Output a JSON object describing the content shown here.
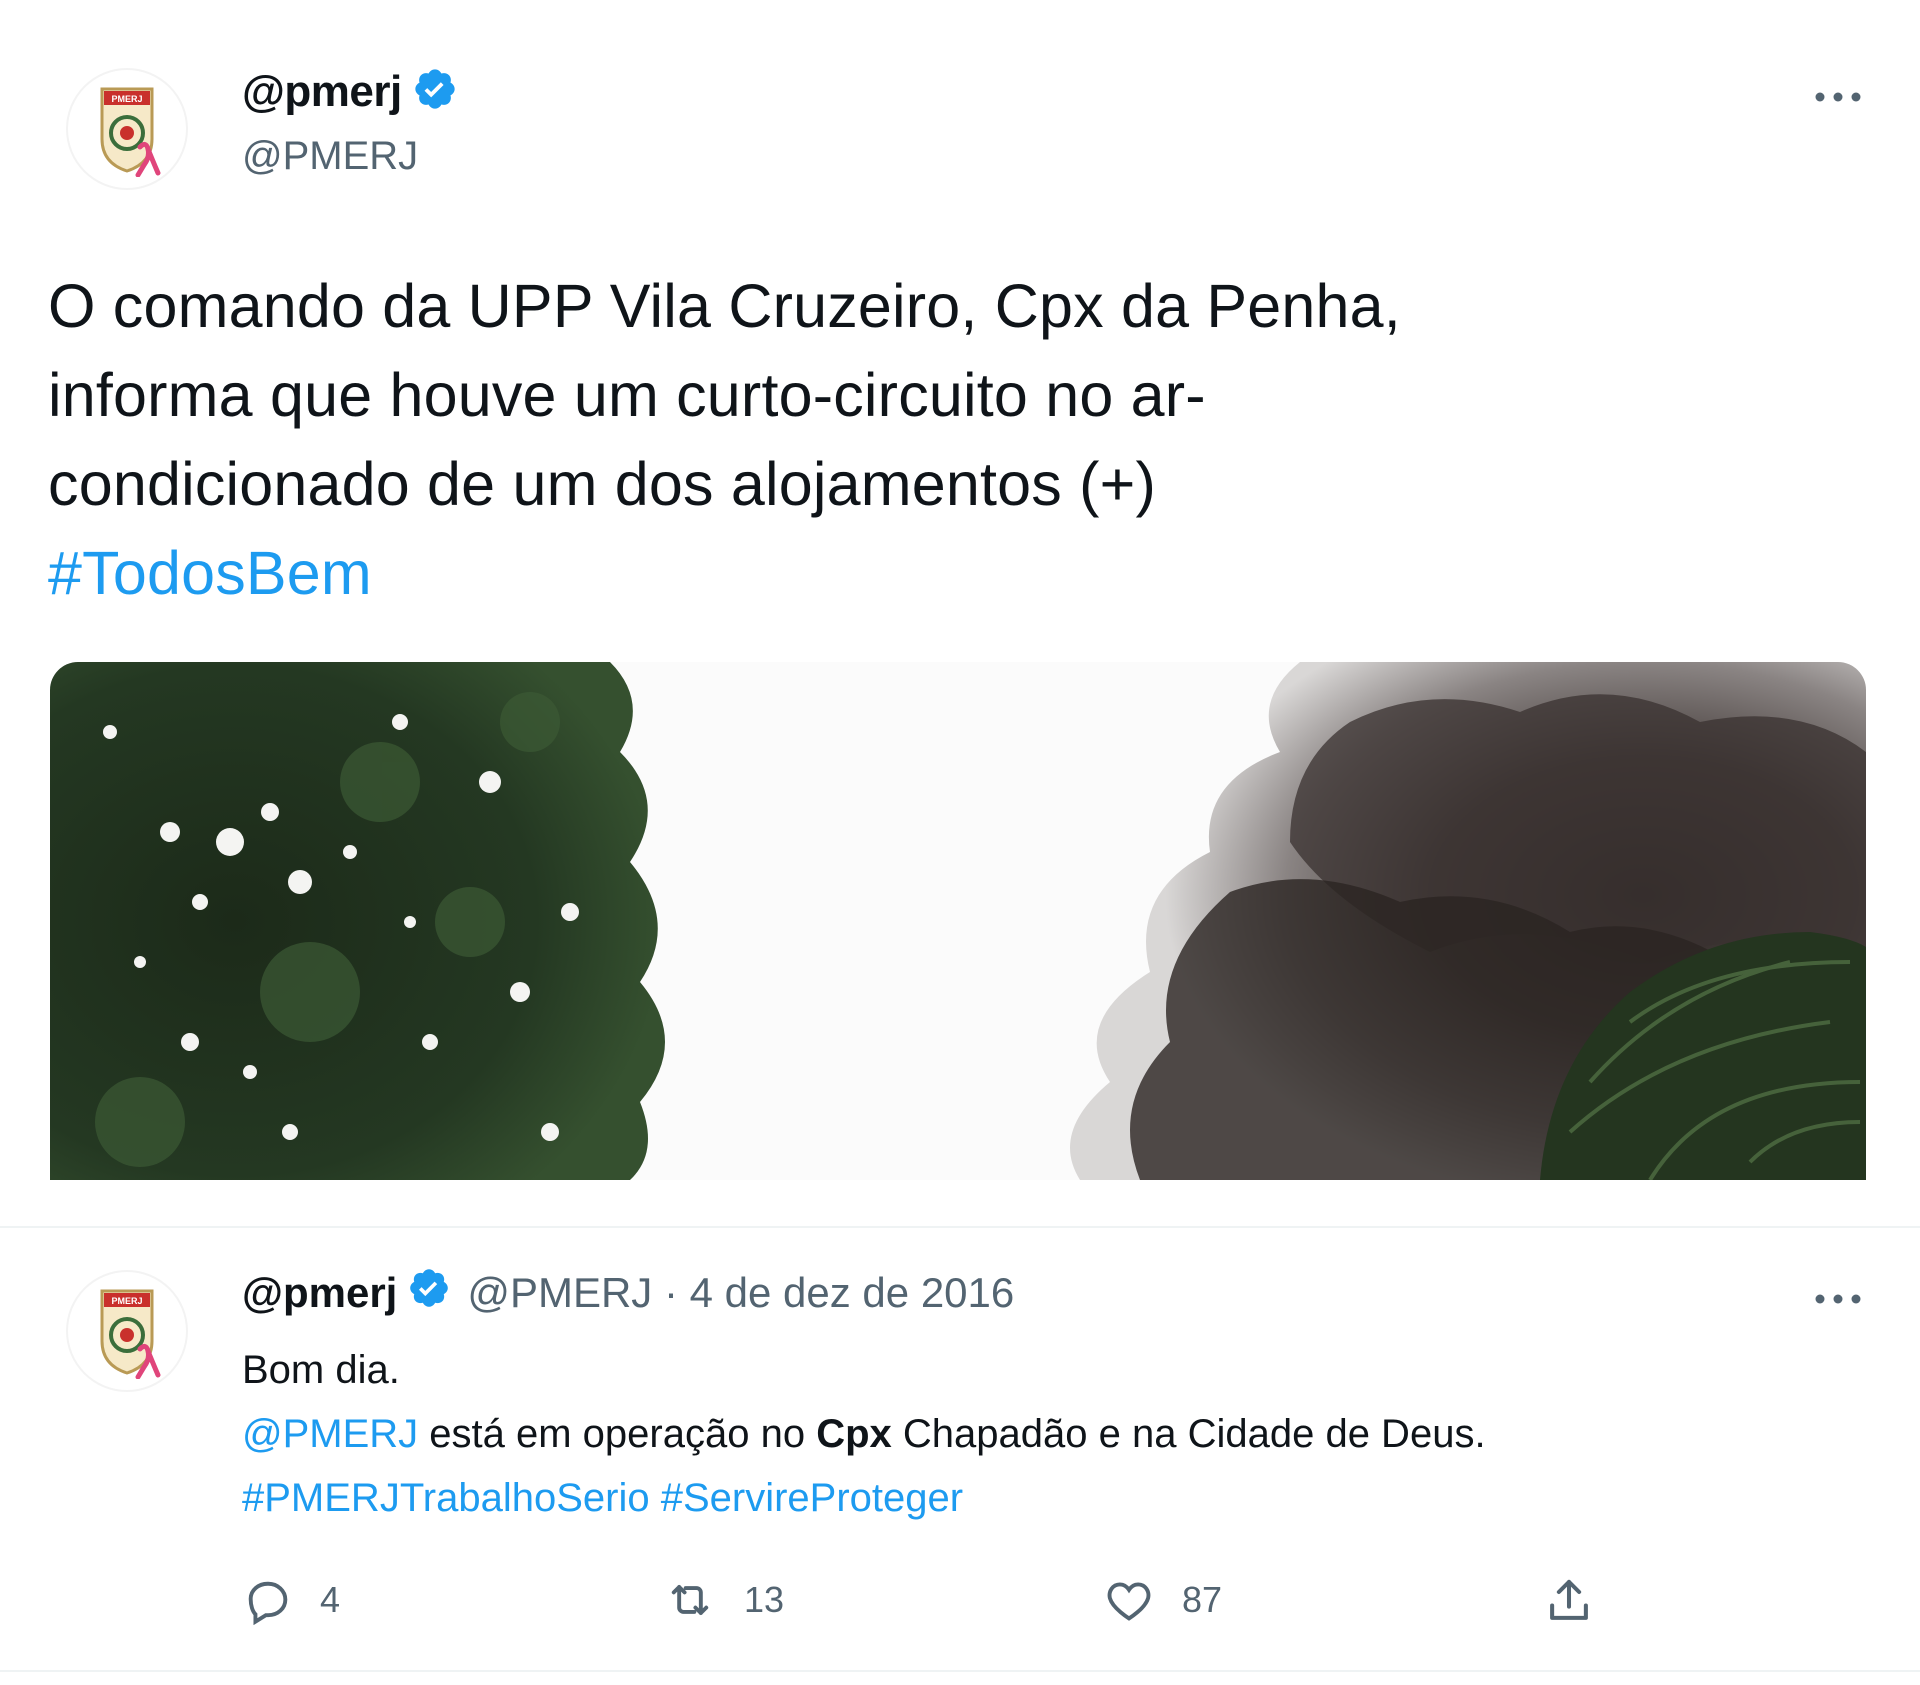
{
  "main_tweet": {
    "display_name": "@pmerj",
    "handle": "@PMERJ",
    "text_lines": [
      "O comando da UPP Vila Cruzeiro, Cpx da Penha,",
      "informa que houve um curto-circuito no ar-",
      "condicionado de um dos alojamentos (+)"
    ],
    "hashtag": "#TodosBem",
    "avatar_logo_text": "PMERJ",
    "verified_icon": "verified-badge-icon",
    "more_icon": "more-options-icon"
  },
  "quoted_tweet": {
    "display_name": "@pmerj",
    "meta": "@PMERJ · 4 de dez de 2016",
    "line1": "Bom dia.",
    "line2_mention": "@PMERJ",
    "line2_mid": " está em operação no ",
    "line2_bold": "Cpx",
    "line2_end": " Chapadão e na Cidade de Deus.",
    "hashtag1": "#PMERJTrabalhoSerio",
    "hashtag2": "#ServireProteger",
    "avatar_logo_text": "PMERJ"
  },
  "actions": {
    "reply_count": "4",
    "retweet_count": "13",
    "like_count": "87",
    "icons": [
      "reply-icon",
      "retweet-icon",
      "like-icon",
      "share-icon"
    ]
  },
  "colors": {
    "text": "#0f1419",
    "secondary": "#536471",
    "link": "#1d9bf0",
    "divider": "#eff3f4",
    "ribbon": "#e0457b"
  }
}
